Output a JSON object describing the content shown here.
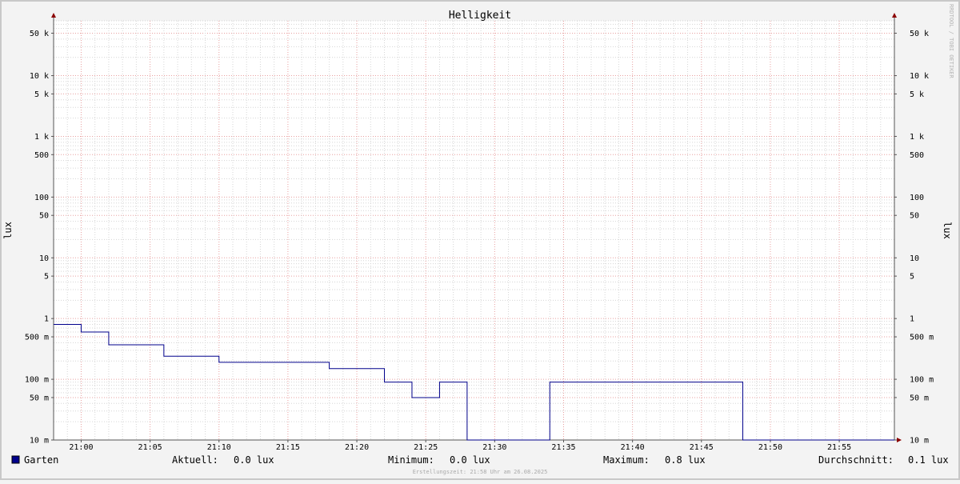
{
  "chart_data": {
    "type": "line",
    "title": "Helligkeit",
    "ylabel": "lux",
    "ylabel_right": "lux",
    "y_scale": "log",
    "ylim": [
      10,
      80000
    ],
    "xlim": [
      "20:58",
      "21:59"
    ],
    "y_ticks": [
      {
        "v": 10,
        "label": "10 m"
      },
      {
        "v": 50,
        "label": "50 m"
      },
      {
        "v": 100,
        "label": "100 m"
      },
      {
        "v": 500,
        "label": "500 m"
      },
      {
        "v": 1000,
        "label": "1"
      },
      {
        "v": 5000,
        "label": "5"
      },
      {
        "v": 10000,
        "label": "10"
      },
      {
        "v": 50000,
        "label": "50"
      },
      {
        "v": 100000,
        "label": "100"
      },
      {
        "v": 500000,
        "label": "500"
      },
      {
        "v": 1000000,
        "label": "1 k"
      },
      {
        "v": 5000000,
        "label": "5 k"
      },
      {
        "v": 10000000,
        "label": "10 k"
      },
      {
        "v": 50000000,
        "label": "50 k"
      }
    ],
    "x_ticks": [
      "21:00",
      "21:05",
      "21:10",
      "21:15",
      "21:20",
      "21:25",
      "21:30",
      "21:35",
      "21:40",
      "21:45",
      "21:50",
      "21:55"
    ],
    "grid": true,
    "legend_position": "bottom-left",
    "series": [
      {
        "name": "Garten",
        "color": "#00008b",
        "points": [
          {
            "x": "20:58",
            "y": 0.8
          },
          {
            "x": "21:00",
            "y": 0.8
          },
          {
            "x": "21:00",
            "y": 0.6
          },
          {
            "x": "21:02",
            "y": 0.6
          },
          {
            "x": "21:02",
            "y": 0.37
          },
          {
            "x": "21:06",
            "y": 0.37
          },
          {
            "x": "21:06",
            "y": 0.24
          },
          {
            "x": "21:10",
            "y": 0.24
          },
          {
            "x": "21:10",
            "y": 0.19
          },
          {
            "x": "21:18",
            "y": 0.19
          },
          {
            "x": "21:18",
            "y": 0.15
          },
          {
            "x": "21:22",
            "y": 0.15
          },
          {
            "x": "21:22",
            "y": 0.09
          },
          {
            "x": "21:24",
            "y": 0.09
          },
          {
            "x": "21:24",
            "y": 0.05
          },
          {
            "x": "21:26",
            "y": 0.05
          },
          {
            "x": "21:26",
            "y": 0.09
          },
          {
            "x": "21:28",
            "y": 0.09
          },
          {
            "x": "21:28",
            "y": 0.0
          },
          {
            "x": "21:34",
            "y": 0.0
          },
          {
            "x": "21:34",
            "y": 0.09
          },
          {
            "x": "21:48",
            "y": 0.09
          },
          {
            "x": "21:48",
            "y": 0.0
          },
          {
            "x": "21:59",
            "y": 0.0
          }
        ]
      }
    ]
  },
  "legend": {
    "series_name": "Garten",
    "series_color": "#00008b",
    "current_label": "Aktuell:",
    "current_value": "0.0 lux",
    "min_label": "Minimum:",
    "min_value": "0.0 lux",
    "max_label": "Maximum:",
    "max_value": "0.8 lux",
    "avg_label": "Durchschnitt:",
    "avg_value": "0.1 lux"
  },
  "footer": "Erstellungszeit: 21:58 Uhr am 26.08.2025",
  "watermark": "RRDTOOL / TOBI OETIKER"
}
